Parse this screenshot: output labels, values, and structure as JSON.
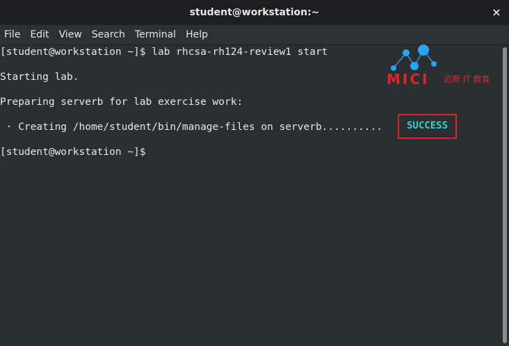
{
  "window": {
    "title": "student@workstation:~",
    "close_glyph": "×"
  },
  "menu": [
    "File",
    "Edit",
    "View",
    "Search",
    "Terminal",
    "Help"
  ],
  "terminal": {
    "lines": [
      "[student@workstation ~]$ lab rhcsa-rh124-review1 start",
      "",
      "Starting lab.",
      "",
      "Preparing serverb for lab exercise work:",
      "",
      " · Creating /home/student/bin/manage-files on serverb..........",
      "",
      "[student@workstation ~]$"
    ],
    "status": "SUCCESS",
    "status_color": "#34d0d0"
  },
  "watermark": {
    "brand": "MICI",
    "subtitle": "迈斯 IT 教育",
    "color": "#e0242c"
  }
}
